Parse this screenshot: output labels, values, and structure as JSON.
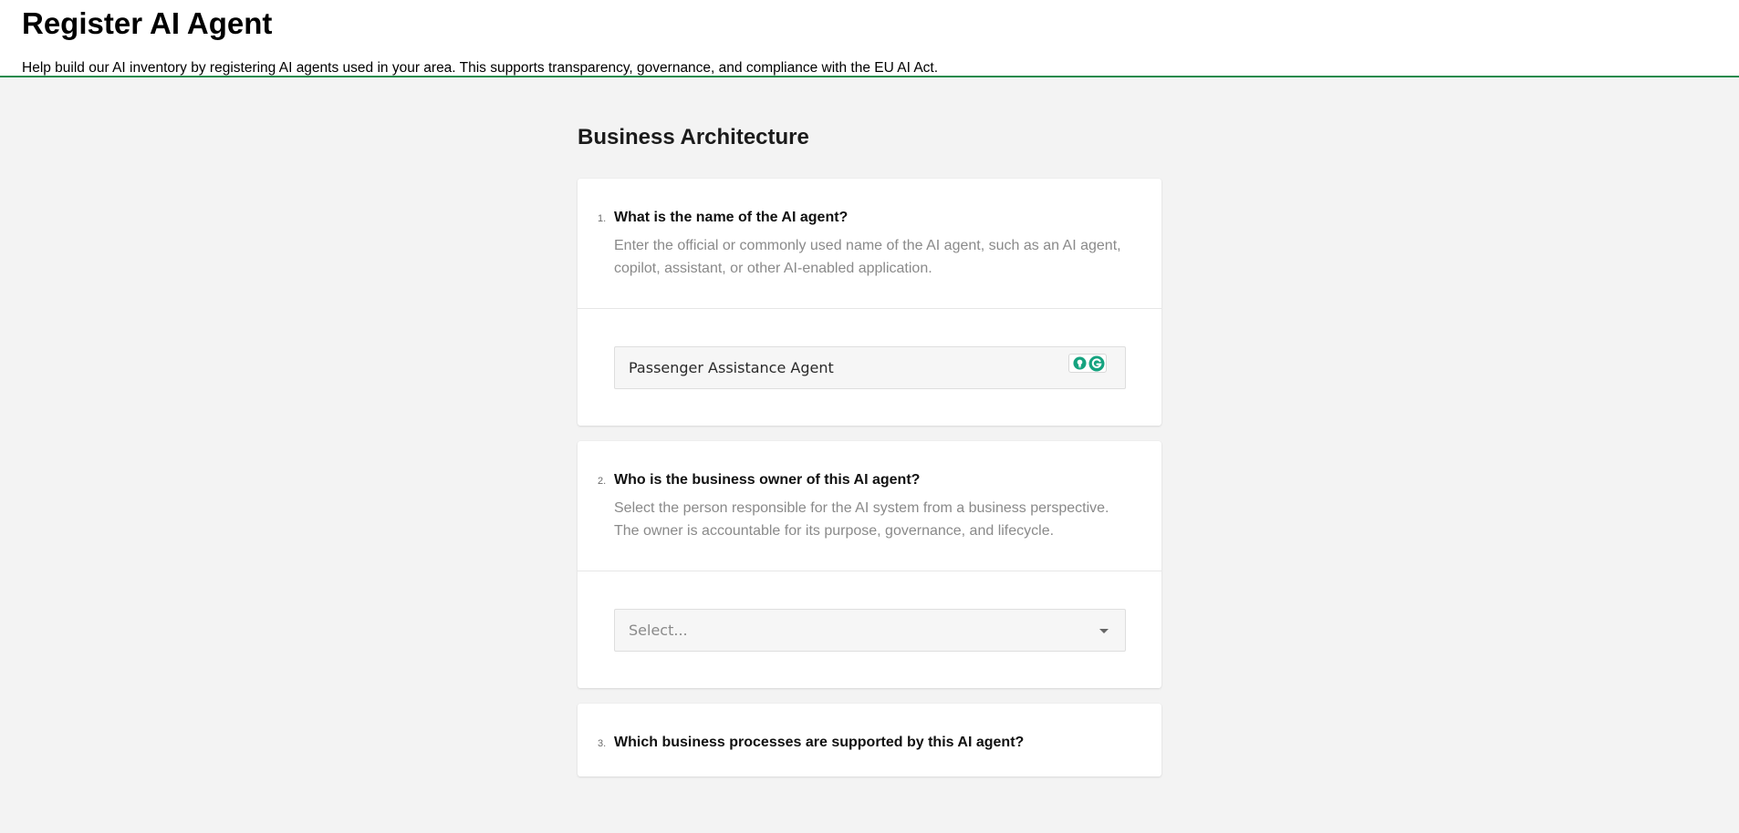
{
  "header": {
    "title": "Register AI Agent",
    "subtitle": "Help build our AI inventory by registering AI agents used in your area. This supports transparency, governance, and compliance with the EU AI Act."
  },
  "section": {
    "title": "Business Architecture"
  },
  "questions": [
    {
      "number": "1.",
      "title": "What is the name of the AI agent?",
      "description": "Enter the official or commonly used name of the AI agent, such as an AI agent, copilot, assistant, or other AI-enabled application.",
      "input_value": "Passenger Assistance Agent",
      "input_icons": [
        "bulb-icon",
        "grammarly-icon"
      ]
    },
    {
      "number": "2.",
      "title": "Who is the business owner of this AI agent?",
      "description": "Select the person responsible for the AI system from a business perspective. The owner is accountable for its purpose, governance, and lifecycle.",
      "select_placeholder": "Select...",
      "select_icon": "chevron-down-icon"
    },
    {
      "number": "3.",
      "title": "Which business processes are supported by this AI agent?"
    }
  ],
  "colors": {
    "accent_line": "#1f8a4c",
    "grammarly": "#15a37f",
    "page_background": "#f3f3f3",
    "card_background": "#ffffff"
  }
}
